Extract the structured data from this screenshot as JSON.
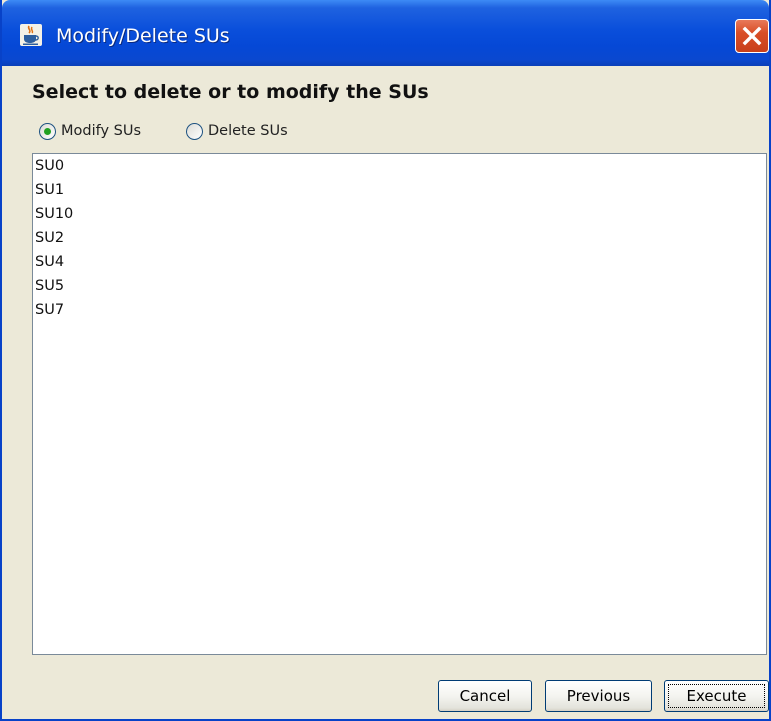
{
  "window": {
    "title": "Modify/Delete SUs",
    "title_icon": "java-cup-icon",
    "close_icon": "close-icon"
  },
  "main": {
    "heading": "Select to delete or to modify the SUs",
    "options": [
      {
        "label": "Modify SUs",
        "selected": true
      },
      {
        "label": "Delete SUs",
        "selected": false
      }
    ],
    "items": [
      "SU0",
      "SU1",
      "SU10",
      "SU2",
      "SU4",
      "SU5",
      "SU7"
    ]
  },
  "buttons": {
    "cancel": "Cancel",
    "previous": "Previous",
    "execute": "Execute"
  },
  "colors": {
    "titlebar": "#0548d6",
    "close_button": "#d94e27",
    "window_bg": "#ece9d8",
    "radio_selected": "#21a121"
  }
}
